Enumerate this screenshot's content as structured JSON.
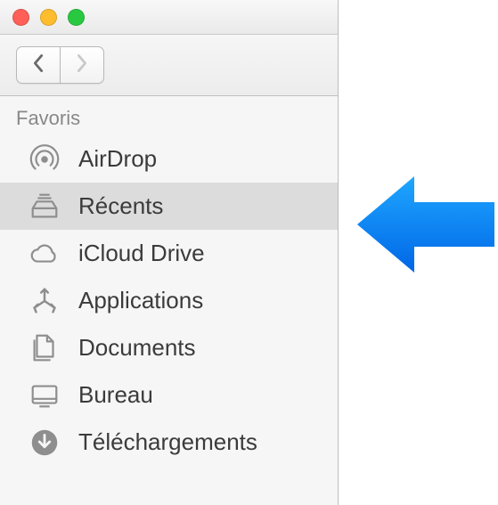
{
  "sidebar": {
    "section_title": "Favoris",
    "items": [
      {
        "label": "AirDrop"
      },
      {
        "label": "Récents"
      },
      {
        "label": "iCloud Drive"
      },
      {
        "label": "Applications"
      },
      {
        "label": "Documents"
      },
      {
        "label": "Bureau"
      },
      {
        "label": "Téléchargements"
      }
    ]
  }
}
